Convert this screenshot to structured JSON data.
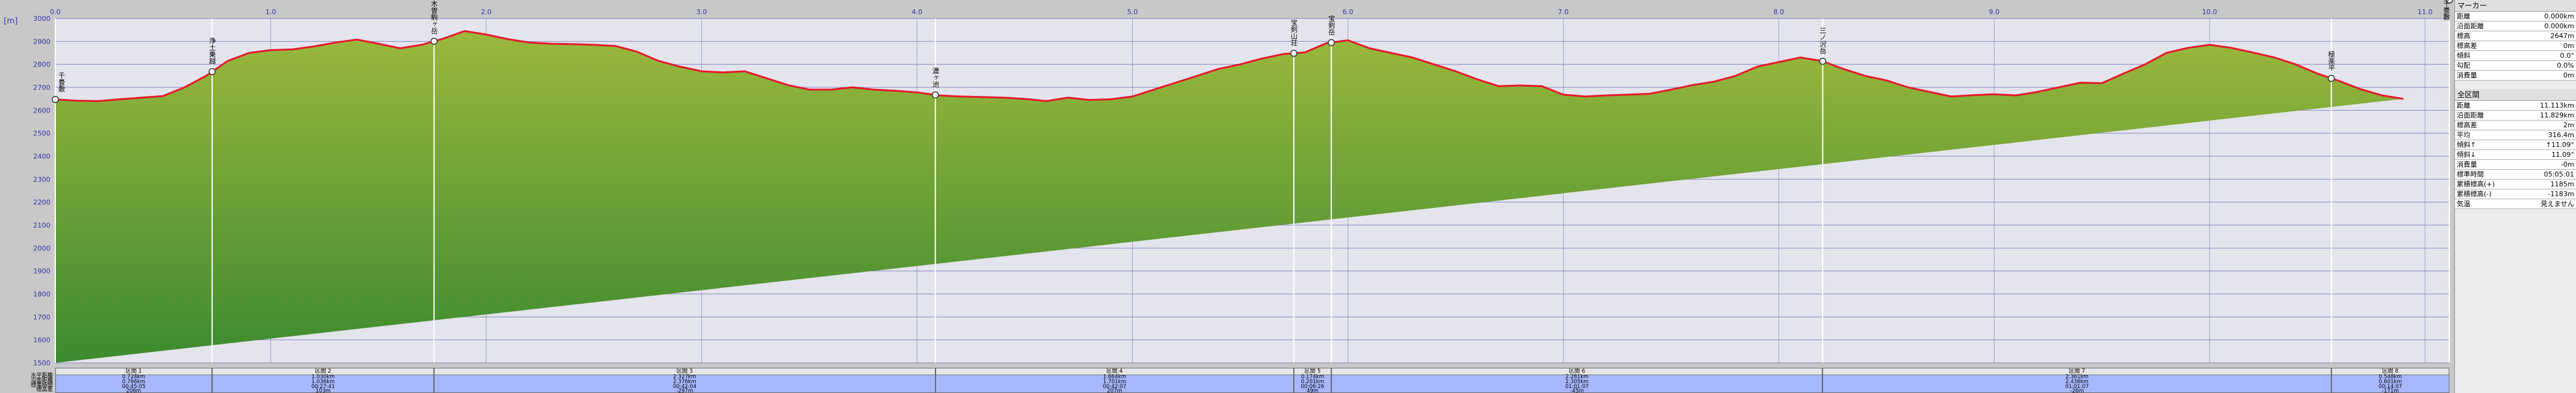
{
  "chart_data": {
    "type": "area",
    "xlabel": "",
    "ylabel": "[m]",
    "xlim": [
      0.0,
      11.113
    ],
    "ylim": [
      1500,
      3000
    ],
    "x_ticks": [
      "0.0",
      "1.0",
      "2.0",
      "3.0",
      "4.0",
      "5.0",
      "6.0",
      "7.0",
      "8.0",
      "9.0",
      "10.0",
      "11.0"
    ],
    "y_ticks": [
      "1500",
      "1600",
      "1700",
      "1800",
      "1900",
      "2000",
      "2100",
      "2200",
      "2300",
      "2400",
      "2500",
      "2600",
      "2700",
      "2800",
      "2900",
      "3000"
    ],
    "grid": true,
    "colors": {
      "line": "#e8182a",
      "fill_top": "#9bb83c",
      "fill_bottom": "#3c8a30",
      "plot_bg": "#e4e4ec",
      "waypoint_line": "#ffffff"
    },
    "x": [
      0.0,
      0.1,
      0.2,
      0.3,
      0.4,
      0.5,
      0.6,
      0.7,
      0.8,
      0.9,
      1.0,
      1.1,
      1.2,
      1.3,
      1.4,
      1.5,
      1.6,
      1.7,
      1.8,
      1.9,
      2.0,
      2.1,
      2.2,
      2.3,
      2.4,
      2.5,
      2.6,
      2.7,
      2.8,
      2.9,
      3.0,
      3.1,
      3.2,
      3.3,
      3.4,
      3.5,
      3.6,
      3.7,
      3.8,
      3.9,
      4.0,
      4.1,
      4.2,
      4.3,
      4.4,
      4.5,
      4.6,
      4.7,
      4.8,
      4.9,
      5.0,
      5.1,
      5.2,
      5.3,
      5.4,
      5.5,
      5.6,
      5.7,
      5.8,
      5.9,
      6.0,
      6.1,
      6.2,
      6.3,
      6.4,
      6.5,
      6.6,
      6.7,
      6.8,
      6.9,
      7.0,
      7.1,
      7.2,
      7.3,
      7.4,
      7.5,
      7.6,
      7.7,
      7.8,
      7.9,
      8.0,
      8.1,
      8.2,
      8.3,
      8.4,
      8.5,
      8.6,
      8.7,
      8.8,
      8.9,
      9.0,
      9.1,
      9.2,
      9.3,
      9.4,
      9.5,
      9.6,
      9.7,
      9.8,
      9.9,
      10.0,
      10.1,
      10.2,
      10.3,
      10.4,
      10.5,
      10.6,
      10.7,
      10.8,
      10.9,
      11.0,
      11.113
    ],
    "y": [
      2647,
      2642,
      2640,
      2648,
      2655,
      2662,
      2700,
      2750,
      2815,
      2850,
      2862,
      2865,
      2878,
      2895,
      2908,
      2890,
      2870,
      2885,
      2912,
      2945,
      2930,
      2910,
      2895,
      2890,
      2888,
      2885,
      2880,
      2855,
      2815,
      2790,
      2770,
      2765,
      2770,
      2740,
      2710,
      2690,
      2690,
      2700,
      2690,
      2685,
      2678,
      2665,
      2660,
      2658,
      2655,
      2650,
      2640,
      2655,
      2645,
      2648,
      2660,
      2690,
      2720,
      2750,
      2780,
      2800,
      2825,
      2845,
      2852,
      2892,
      2905,
      2870,
      2850,
      2830,
      2800,
      2770,
      2735,
      2705,
      2708,
      2705,
      2668,
      2660,
      2665,
      2668,
      2672,
      2690,
      2710,
      2725,
      2750,
      2790,
      2810,
      2830,
      2815,
      2780,
      2750,
      2730,
      2700,
      2680,
      2660,
      2666,
      2670,
      2665,
      2680,
      2700,
      2720,
      2718,
      2760,
      2800,
      2850,
      2872,
      2885,
      2872,
      2852,
      2830,
      2800,
      2760,
      2728,
      2692,
      2665,
      2650
    ],
    "waypoints": [
      {
        "x": 0.0,
        "label": "千畳敷"
      },
      {
        "x": 0.728,
        "label": "浄土乗越"
      },
      {
        "x": 1.758,
        "label": "木曽駒ヶ岳"
      },
      {
        "x": 4.085,
        "label": "濃ヶ池"
      },
      {
        "x": 5.749,
        "label": "宝剣山荘"
      },
      {
        "x": 5.923,
        "label": "宝剣岳"
      },
      {
        "x": 8.204,
        "label": "三ノ沢岳"
      },
      {
        "x": 10.565,
        "label": "極楽平"
      },
      {
        "x": 11.113,
        "label": "千畳敷"
      }
    ]
  },
  "segments": [
    {
      "name": "区間 1",
      "distance": "0.728km",
      "surface": "0.766km",
      "time": "00:45:05",
      "elev": "206m"
    },
    {
      "name": "区間 2",
      "distance": "1.030km",
      "surface": "1.036km",
      "time": "00:27:41",
      "elev": "103m"
    },
    {
      "name": "区間 3",
      "distance": "2.327km",
      "surface": "2.376km",
      "time": "00:42:04",
      "elev": "-297m"
    },
    {
      "name": "区間 4",
      "distance": "1.664km",
      "surface": "1.701km",
      "time": "00:42:07",
      "elev": "207m"
    },
    {
      "name": "区間 5",
      "distance": "0.174km",
      "surface": "0.201km",
      "time": "00:06:26",
      "elev": "49m"
    },
    {
      "name": "区間 6",
      "distance": "2.281km",
      "surface": "2.305km",
      "time": "01:01:07",
      "elev": "-45m"
    },
    {
      "name": "区間 7",
      "distance": "2.361km",
      "surface": "2.436km",
      "time": "01:01:07",
      "elev": "-26m"
    },
    {
      "name": "区間 8",
      "distance": "0.548km",
      "surface": "0.601km",
      "time": "00:14:07",
      "elev": "-171m"
    }
  ],
  "row_labels": {
    "distance": "水平距離",
    "surface": "沿面距離",
    "time": "標準時間",
    "elev": "標高差"
  },
  "panel": {
    "marker_title": "マーカー",
    "marker_rows": [
      {
        "label": "距離",
        "value": "0.000km"
      },
      {
        "label": "沿面距離",
        "value": "0.000km"
      },
      {
        "label": "標高",
        "value": "2647m"
      },
      {
        "label": "標高差",
        "value": "0m"
      },
      {
        "label": "傾斜",
        "value": "0.0°"
      },
      {
        "label": "勾配",
        "value": "0.0%"
      },
      {
        "label": "消費量",
        "value": "0m"
      }
    ],
    "total_title": "全区間",
    "total_rows": [
      {
        "label": "距離",
        "value": "11.113km"
      },
      {
        "label": "沿面距離",
        "value": "11.829km"
      },
      {
        "label": "標高差",
        "value": "2m"
      },
      {
        "label": "平均",
        "value": "316.4m"
      },
      {
        "label": "傾斜↑",
        "value": "↑11.09°"
      },
      {
        "label": "傾斜↓",
        "value": "11.09°"
      },
      {
        "label": "消費量",
        "value": "-0m"
      },
      {
        "label": "標準時間",
        "value": "05:05:01"
      },
      {
        "label": "累積標高(+)",
        "value": "1185m"
      },
      {
        "label": "累積標高(-)",
        "value": "-1183m"
      },
      {
        "label": "気温",
        "value": "見えません"
      }
    ]
  }
}
